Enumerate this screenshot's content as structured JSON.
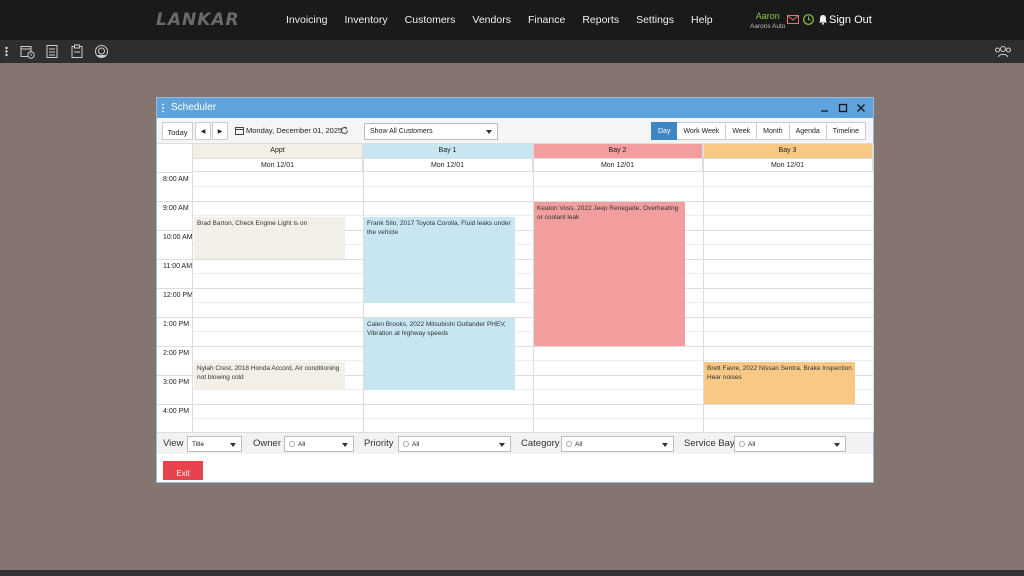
{
  "app": {
    "logo": "LANKAR",
    "nav": [
      "Invoicing",
      "Inventory",
      "Customers",
      "Vendors",
      "Finance",
      "Reports",
      "Settings",
      "Help"
    ],
    "user_name": "Aaron",
    "user_org": "Aarons Auto",
    "sign_out": "Sign Out"
  },
  "window": {
    "title": "Scheduler"
  },
  "toolbar": {
    "today": "Today",
    "prev": "◀",
    "next": "▶",
    "date": "Monday, December 01, 2025",
    "customer_filter": "Show All Customers",
    "views": [
      "Day",
      "Work Week",
      "Week",
      "Month",
      "Agenda",
      "Timeline"
    ],
    "active_view": "Day"
  },
  "resources": [
    {
      "name": "Appt",
      "day": "Mon 12/01",
      "color": "#f1efe6"
    },
    {
      "name": "Bay 1",
      "day": "Mon 12/01",
      "color": "#c7e6f2"
    },
    {
      "name": "Bay 2",
      "day": "Mon 12/01",
      "color": "#f29e9f"
    },
    {
      "name": "Bay 3",
      "day": "Mon 12/01",
      "color": "#f7c985"
    }
  ],
  "times": [
    "8:00 AM",
    "9:00 AM",
    "10:00 AM",
    "11:00 AM",
    "12:00 PM",
    "1:00 PM",
    "2:00 PM",
    "3:00 PM",
    "4:00 PM"
  ],
  "events": [
    {
      "resource": 0,
      "start": 9.5,
      "end": 11.0,
      "text": "Brad Barton, Check Engine Light is on"
    },
    {
      "resource": 0,
      "start": 14.5,
      "end": 15.5,
      "text": "Nylah Crest, 2018 Honda Accord, Air conditioning not blowing cold"
    },
    {
      "resource": 1,
      "start": 9.5,
      "end": 12.5,
      "text": "Frank Silo, 2017 Toyota Corolla, Fluid leaks under the vehicle"
    },
    {
      "resource": 1,
      "start": 13.0,
      "end": 15.5,
      "text": "Calen Brooks, 2022 Mitsubishi Outlander PHEV, Vibration at highway speeds"
    },
    {
      "resource": 2,
      "start": 9.0,
      "end": 14.0,
      "text": "Keaton Voss, 2022 Jeep Renegade, Overheating or coolant leak"
    },
    {
      "resource": 3,
      "start": 14.5,
      "end": 16.0,
      "text": "Brett Favre, 2022 Nissan Sentra, Brake Inspection Hear noises"
    }
  ],
  "filters": {
    "view_label": "View",
    "view_value": "Title",
    "owner_label": "Owner",
    "owner_value": "All",
    "priority_label": "Priority",
    "priority_value": "All",
    "category_label": "Category",
    "category_value": "All",
    "service_bay_label": "Service Bay",
    "service_bay_value": "All"
  },
  "exit_label": "Exit",
  "colors": {
    "nav_bg": "#1a1a1a",
    "page_bg": "#857570",
    "title_bar": "#5ea3dc",
    "active_view": "#3d86c6",
    "exit": "#e8424e"
  }
}
